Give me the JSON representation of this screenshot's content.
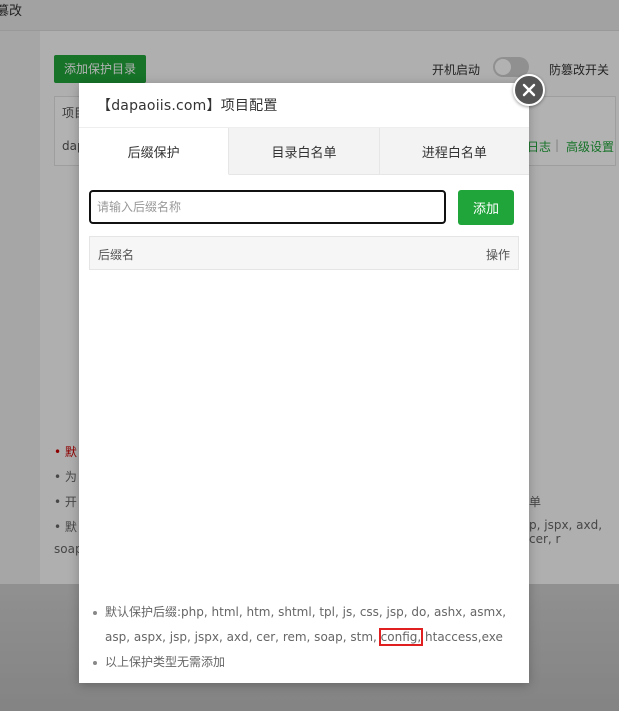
{
  "background": {
    "title_fragment": "篡改",
    "add_dir_button": "添加保护目录",
    "boot_label": "开机启动",
    "tamper_switch_label": "防篡改开关",
    "table_header_fragment": "项目",
    "table_row_fragment": "dap",
    "log_link": "日志",
    "separator": "|",
    "advanced_link": "高级设置",
    "notes": [
      {
        "text": "默",
        "red": true
      },
      {
        "text": "为"
      },
      {
        "text": "开",
        "tail": "单"
      },
      {
        "text": "默",
        "tail": "p, jspx, axd, cer, r"
      },
      {
        "text": "soap"
      }
    ]
  },
  "dialog": {
    "title": "【dapaoiis.com】项目配置",
    "tabs": [
      {
        "label": "后缀保护",
        "active": true
      },
      {
        "label": "目录白名单",
        "active": false
      },
      {
        "label": "进程白名单",
        "active": false
      }
    ],
    "input": {
      "placeholder": "请输入后缀名称",
      "value": ""
    },
    "add_button": "添加",
    "table": {
      "columns": [
        "后缀名",
        "操作"
      ],
      "rows": []
    },
    "tips": {
      "default_prefix": "默认保护后缀:php, html, htm, shtml, tpl, js, css, jsp, do, ashx, asmx, asp, aspx, jsp, jspx, axd, cer, rem, soap, stm, ",
      "highlighted": "config,",
      "default_suffix": " htaccess,exe",
      "no_need": "以上保护类型无需添加"
    }
  },
  "colors": {
    "accent": "#20a53a",
    "highlight": "#e02020"
  }
}
